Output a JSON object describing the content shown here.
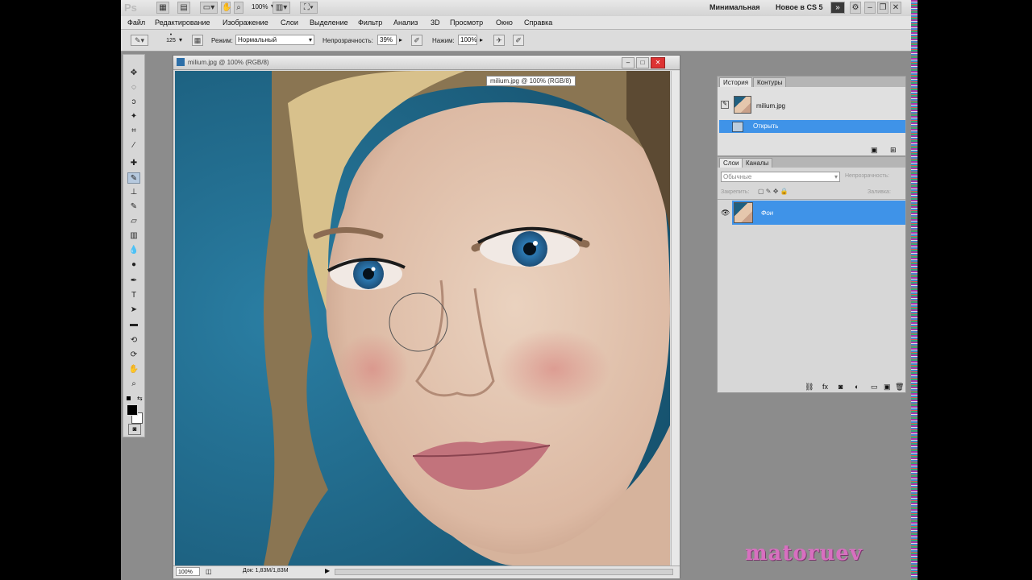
{
  "appbar": {
    "logo": "Ps",
    "zoom": "100%",
    "workspace": "Минимальная",
    "new_in_cs5": "Новое в CS 5",
    "more_symbol": "»"
  },
  "menu": [
    "Файл",
    "Редактирование",
    "Изображение",
    "Слои",
    "Выделение",
    "Фильтр",
    "Анализ",
    "3D",
    "Просмотр",
    "Окно",
    "Справка"
  ],
  "options": {
    "brush_size": "125",
    "mode_label": "Режим:",
    "mode_value": "Нормальный",
    "opacity_label": "Непрозрачность:",
    "opacity_value": "39%",
    "pressure_label": "Нажим:",
    "pressure_value": "100%"
  },
  "document": {
    "title": "milium.jpg @ 100% (RGB/8)",
    "tooltip": "milium.jpg @ 100% (RGB/8)",
    "zoom": "100%",
    "doc_info": "Док: 1,83M/1,83M"
  },
  "history_panel": {
    "tabs": [
      "История",
      "Контуры"
    ],
    "snapshot": "milium.jpg",
    "step": "Открыть"
  },
  "layers_panel": {
    "tabs": [
      "Слои",
      "Каналы"
    ],
    "blend_mode": "Обычные",
    "opacity_label": "Непрозрачность:",
    "lock_label": "Закрепить:",
    "fill_label": "Заливка:",
    "layer_name": "Фон"
  },
  "watermark": "matoruev",
  "colors": {
    "selection": "#3f93e8",
    "app_bg": "#8c8c8c",
    "watermark": "#d86fc0"
  }
}
